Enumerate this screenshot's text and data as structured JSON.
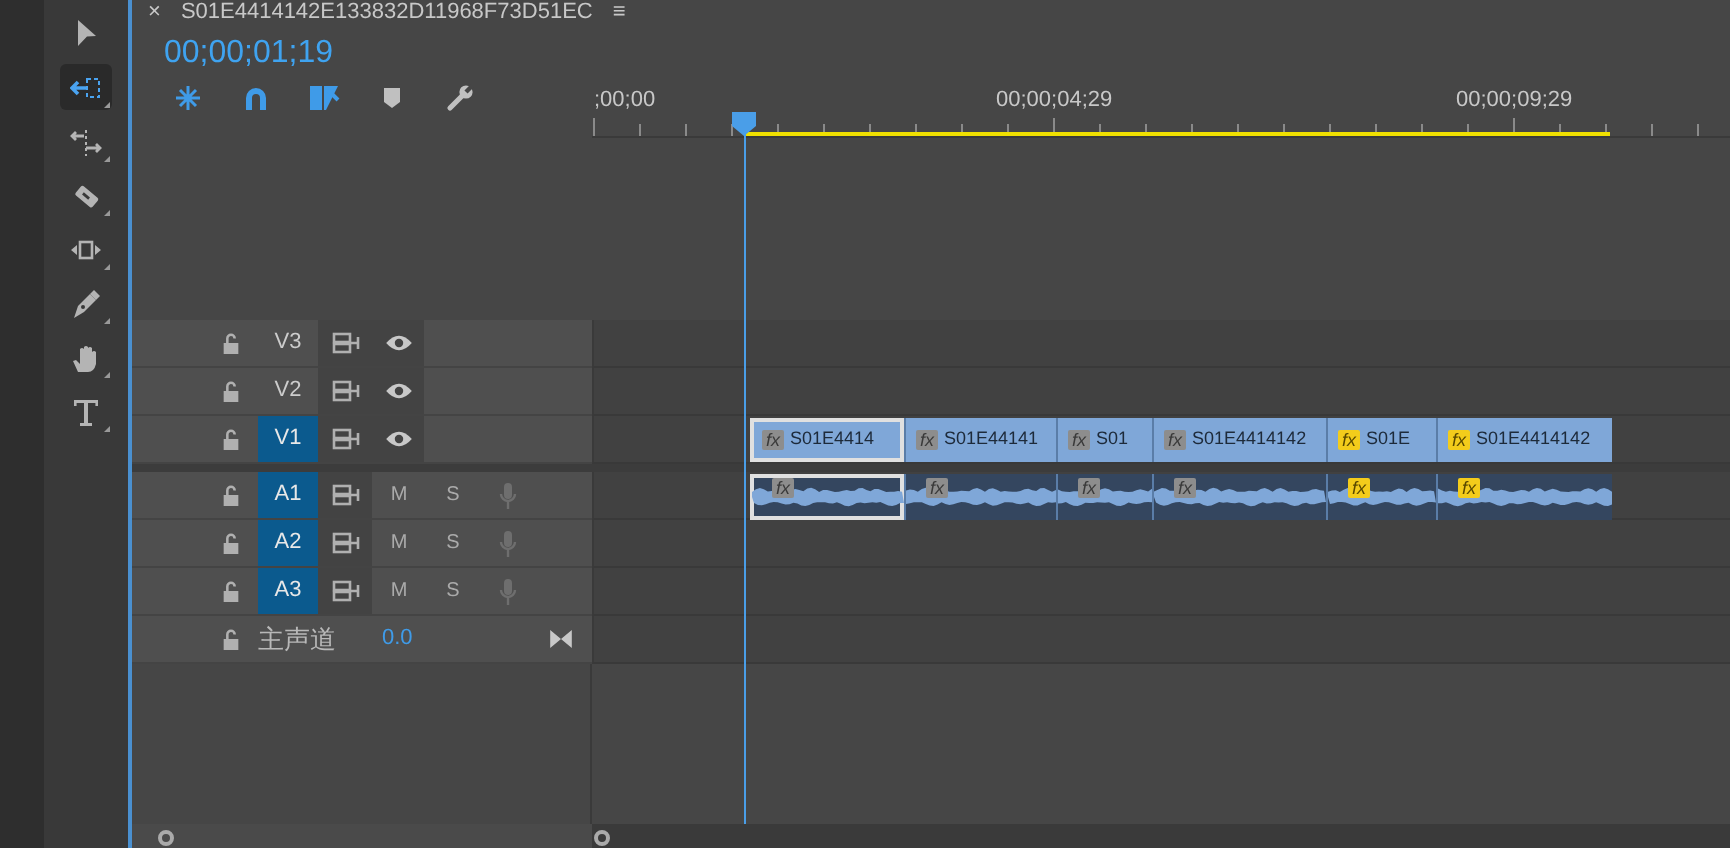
{
  "tools": [
    {
      "kind": "select",
      "selected": false
    },
    {
      "kind": "track_select",
      "selected": true
    },
    {
      "kind": "ripple",
      "selected": false
    },
    {
      "kind": "razor",
      "selected": false
    },
    {
      "kind": "slip",
      "selected": false
    },
    {
      "kind": "pen",
      "selected": false
    },
    {
      "kind": "hand",
      "selected": false
    },
    {
      "kind": "type",
      "selected": false
    }
  ],
  "sequence_tab": {
    "close": "×",
    "title": "S01E4414142E133832D11968F73D51EC",
    "menu": "≡"
  },
  "timecode": "00;00;01;19",
  "timeline_tools": [
    {
      "kind": "nest",
      "on": true
    },
    {
      "kind": "snap",
      "on": true
    },
    {
      "kind": "linked",
      "on": true
    },
    {
      "kind": "marker",
      "on": false
    },
    {
      "kind": "wrench",
      "on": false
    }
  ],
  "ruler": {
    "labels": [
      ";00;00",
      "00;00;04;29",
      "00;00;09;29"
    ]
  },
  "video_tracks": [
    {
      "label": "V3",
      "targeted": false
    },
    {
      "label": "V2",
      "targeted": false
    },
    {
      "label": "V1",
      "targeted": true
    }
  ],
  "audio_tracks": [
    {
      "label": "A1",
      "targeted": true,
      "mute": "M",
      "solo": "S"
    },
    {
      "label": "A2",
      "targeted": true,
      "mute": "M",
      "solo": "S"
    },
    {
      "label": "A3",
      "targeted": true,
      "mute": "M",
      "solo": "S"
    }
  ],
  "master": {
    "label": "主声道",
    "value": "0.0"
  },
  "video_clips": [
    {
      "name": "S01E4414",
      "fx": "fx",
      "fx_active": false,
      "selected": true
    },
    {
      "name": "S01E44141",
      "fx": "fx",
      "fx_active": false,
      "selected": false
    },
    {
      "name": "S01",
      "fx": "fx",
      "fx_active": false,
      "selected": false
    },
    {
      "name": "S01E4414142",
      "fx": "fx",
      "fx_active": false,
      "selected": false
    },
    {
      "name": "S01E",
      "fx": "fx",
      "fx_active": true,
      "selected": false
    },
    {
      "name": "S01E4414142",
      "fx": "fx",
      "fx_active": true,
      "selected": false
    }
  ],
  "audio_clips": [
    {
      "fx": "fx",
      "fx_active": false,
      "selected": true
    },
    {
      "fx": "fx",
      "fx_active": false,
      "selected": false
    },
    {
      "fx": "fx",
      "fx_active": false,
      "selected": false
    },
    {
      "fx": "fx",
      "fx_active": false,
      "selected": false
    },
    {
      "fx": "fx",
      "fx_active": true,
      "selected": false
    },
    {
      "fx": "fx",
      "fx_active": true,
      "selected": false
    }
  ]
}
